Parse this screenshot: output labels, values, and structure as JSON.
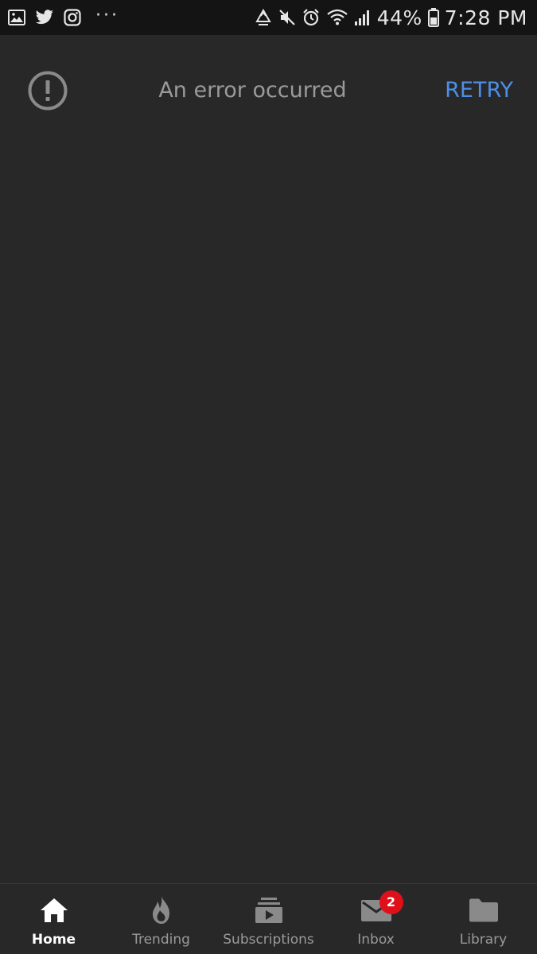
{
  "status_bar": {
    "battery_percent": "44%",
    "time": "7:28 PM",
    "overflow_indicator": "···",
    "left_icons": [
      "gallery-icon",
      "twitter-icon",
      "instagram-icon"
    ],
    "right_icons": [
      "recycle-icon",
      "mute-icon",
      "alarm-icon",
      "wifi-icon",
      "signal-icon",
      "battery-icon"
    ]
  },
  "error_banner": {
    "message": "An error occurred",
    "retry_label": "RETRY",
    "icon": "error-icon",
    "accent_color": "#4d8fe8"
  },
  "bottom_nav": {
    "items": [
      {
        "label": "Home",
        "icon": "home-icon",
        "active": true
      },
      {
        "label": "Trending",
        "icon": "flame-icon",
        "active": false
      },
      {
        "label": "Subscriptions",
        "icon": "subscriptions-icon",
        "active": false
      },
      {
        "label": "Inbox",
        "icon": "mail-icon",
        "active": false,
        "badge": "2"
      },
      {
        "label": "Library",
        "icon": "folder-icon",
        "active": false
      }
    ]
  },
  "colors": {
    "background": "#282828",
    "status_bar": "#141414",
    "badge": "#e0101a"
  }
}
